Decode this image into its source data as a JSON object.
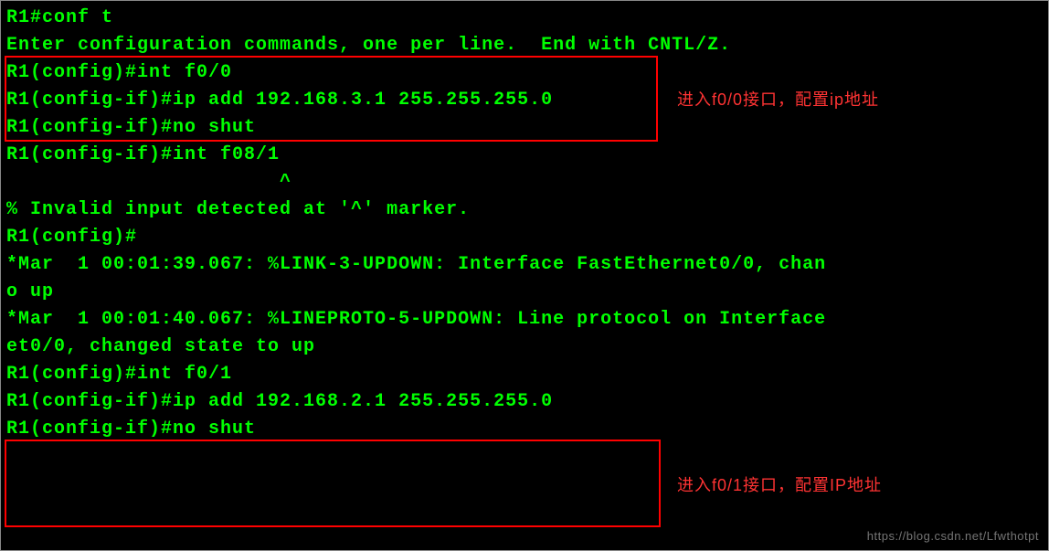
{
  "terminal": {
    "lines": [
      "R1#conf t",
      "Enter configuration commands, one per line.  End with CNTL/Z.",
      "R1(config)#int f0/0",
      "R1(config-if)#ip add 192.168.3.1 255.255.255.0",
      "R1(config-if)#no shut",
      "R1(config-if)#int f08/1",
      "                       ^",
      "% Invalid input detected at '^' marker.",
      "",
      "R1(config)#",
      "*Mar  1 00:01:39.067: %LINK-3-UPDOWN: Interface FastEthernet0/0, chan",
      "o up",
      "*Mar  1 00:01:40.067: %LINEPROTO-5-UPDOWN: Line protocol on Interface",
      "et0/0, changed state to up",
      "R1(config)#int f0/1",
      "R1(config-if)#ip add 192.168.2.1 255.255.255.0",
      "R1(config-if)#no shut"
    ]
  },
  "annotations": {
    "box1_note": "进入f0/0接口，配置ip地址",
    "box2_note": "进入f0/1接口，配置IP地址"
  },
  "watermark": "https://blog.csdn.net/Lfwthotpt"
}
